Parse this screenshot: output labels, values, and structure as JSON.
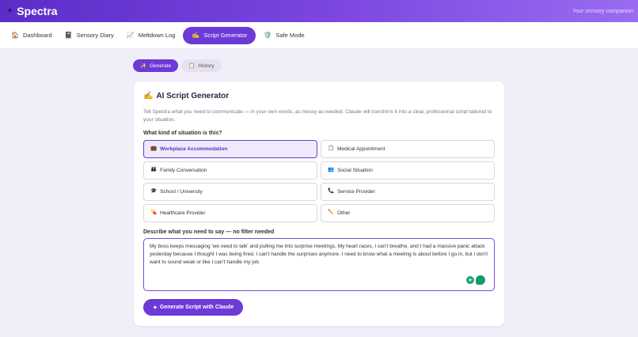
{
  "app": {
    "name": "Spectra",
    "tagline": "Your sensory companion"
  },
  "nav": {
    "tabs": [
      {
        "label": "Dashboard",
        "icon": "house-icon"
      },
      {
        "label": "Sensory Diary",
        "icon": "notebook-icon"
      },
      {
        "label": "Meltdown Log",
        "icon": "chart-icon"
      },
      {
        "label": "Script Generator",
        "icon": "writing-hand-icon",
        "active": true
      },
      {
        "label": "Safe Mode",
        "icon": "shield-icon"
      }
    ]
  },
  "subtabs": {
    "generate": "Generate",
    "history": "History"
  },
  "card": {
    "title": "AI Script Generator",
    "description": "Tell Spectra what you need to communicate — in your own words, as messy as needed. Claude will transform it into a clear, professional script tailored to your situation.",
    "situation_label": "What kind of situation is this?",
    "options": [
      {
        "label": "Workplace Accommodation",
        "icon": "briefcase-icon",
        "selected": true
      },
      {
        "label": "Medical Appointment",
        "icon": "clipboard-icon"
      },
      {
        "label": "Family Conversation",
        "icon": "family-icon"
      },
      {
        "label": "Social Situation",
        "icon": "people-icon"
      },
      {
        "label": "School / University",
        "icon": "graduation-cap-icon"
      },
      {
        "label": "Service Provider",
        "icon": "phone-icon"
      },
      {
        "label": "Healthcare Provider",
        "icon": "pill-icon"
      },
      {
        "label": "Other",
        "icon": "pencil-icon"
      }
    ],
    "describe_label": "Describe what you need to say — no filter needed",
    "message": "My boss keeps messaging 'we need to talk' and pulling me into surprise meetings. My heart races, I can't breathe, and I had a massive panic attack yesterday because I thought I was being fired. I can't handle the surprises anymore. I need to know what a meeting is about before I go in, but I don't want to sound weak or like I can't handle my job.",
    "generate_button": "Generate Script with Claude"
  },
  "colors": {
    "accent": "#6c3ad6",
    "header_start": "#5b2dc8",
    "header_end": "#9a6cf0",
    "background": "#f1eefa"
  }
}
